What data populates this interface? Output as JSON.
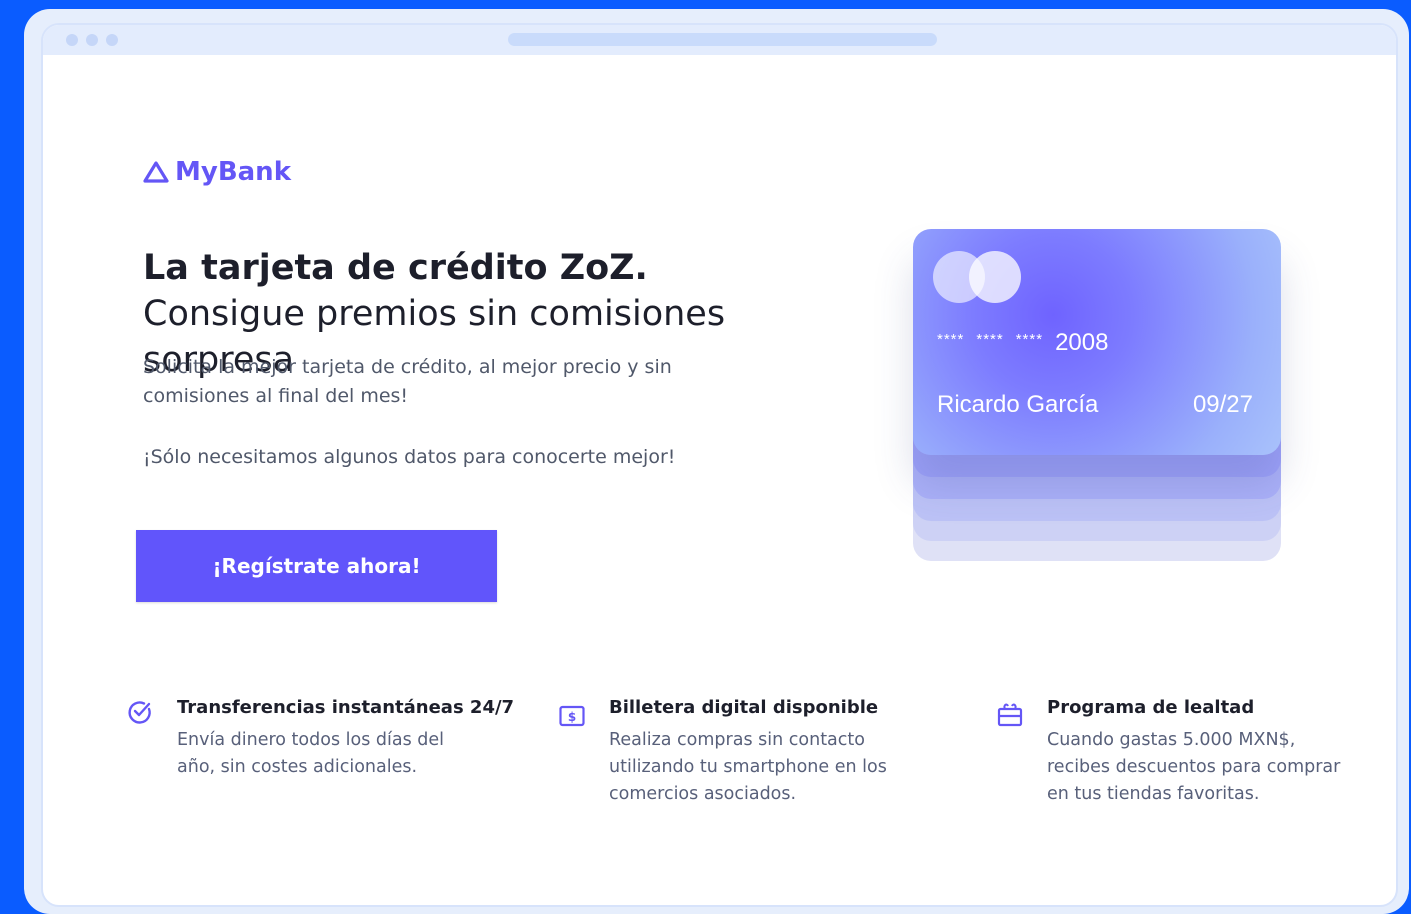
{
  "brand": {
    "name": "MyBank",
    "color": "#6456f6"
  },
  "hero": {
    "title_bold": "La tarjeta de crédito ZoZ.",
    "title_rest": " Consigue premios sin comisiones sorpresa",
    "subtitle": "Solicita la mejor tarjeta de crédito, al mejor precio y sin comisiones al final del mes!",
    "subtitle2": "¡Sólo necesitamos algunos datos para conocerte mejor!",
    "cta_label": "¡Regístrate ahora!"
  },
  "card": {
    "mask1": "****",
    "mask2": "****",
    "mask3": "****",
    "last4": "2008",
    "holder": "Ricardo García",
    "expiry": "09/27"
  },
  "features": [
    {
      "icon": "check-circle-icon",
      "title": "Transferencias instantáneas 24/7",
      "text": "Envía dinero todos los días del año, sin costes adicionales."
    },
    {
      "icon": "dollar-bill-icon",
      "title": "Billetera digital disponible",
      "text": "Realiza compras sin contacto utilizando tu smartphone en los comercios asociados."
    },
    {
      "icon": "gift-box-icon",
      "title": "Programa de lealtad",
      "text": "Cuando gastas 5.000 MXN$, recibes descuentos para comprar en tus tiendas favoritas."
    }
  ],
  "colors": {
    "accent": "#6155fb",
    "background": "#0a5cff"
  }
}
